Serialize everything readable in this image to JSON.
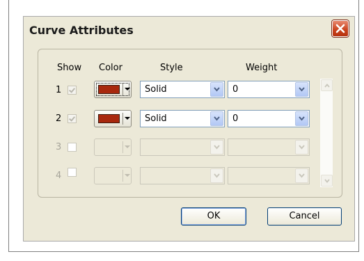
{
  "dialog": {
    "title": "Curve Attributes",
    "close_icon": "close-x-icon",
    "headers": {
      "show": "Show",
      "color": "Color",
      "style": "Style",
      "weight": "Weight"
    },
    "rows": [
      {
        "number": "1",
        "show_checked": true,
        "enabled": true,
        "color": "#a8280e",
        "style": "Solid",
        "weight": "0"
      },
      {
        "number": "2",
        "show_checked": true,
        "enabled": true,
        "color": "#a8280e",
        "style": "Solid",
        "weight": "0"
      },
      {
        "number": "3",
        "show_checked": false,
        "enabled": false,
        "color": "",
        "style": "",
        "weight": ""
      },
      {
        "number": "4",
        "show_checked": false,
        "enabled": false,
        "color": "",
        "style": "",
        "weight": ""
      }
    ],
    "buttons": {
      "ok": "OK",
      "cancel": "Cancel"
    }
  },
  "colors": {
    "accent": "#7f9db9",
    "dialog_bg": "#ece9d8",
    "close_red": "#c9411c"
  }
}
